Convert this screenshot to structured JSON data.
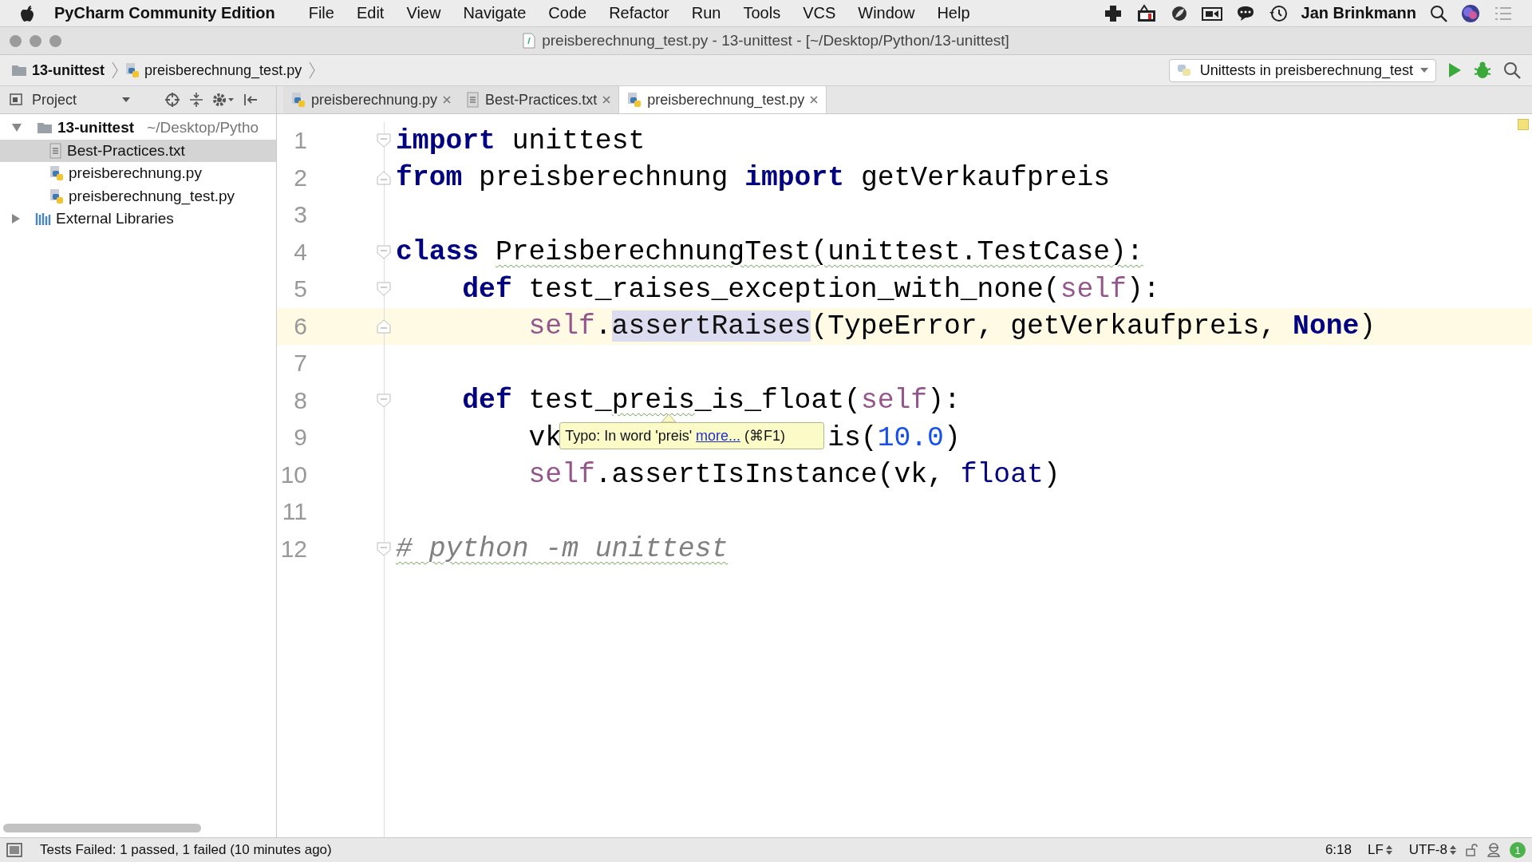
{
  "menu_bar": {
    "app_name": "PyCharm Community Edition",
    "menus": [
      "File",
      "Edit",
      "View",
      "Navigate",
      "Code",
      "Refactor",
      "Run",
      "Tools",
      "VCS",
      "Window",
      "Help"
    ],
    "user": "Jan Brinkmann"
  },
  "window": {
    "title": "preisberechnung_test.py - 13-unittest - [~/Desktop/Python/13-unittest]"
  },
  "breadcrumbs": [
    {
      "label": "13-unittest",
      "kind": "folder"
    },
    {
      "label": "preisberechnung_test.py",
      "kind": "python"
    }
  ],
  "run_config": {
    "label": "Unittests in preisberechnung_test"
  },
  "project_panel": {
    "title": "Project",
    "tree": [
      {
        "label": "13-unittest",
        "path": "~/Desktop/Pytho",
        "kind": "folder",
        "expanded": true,
        "selected": false,
        "children": [
          {
            "label": "Best-Practices.txt",
            "kind": "text",
            "selected": true
          },
          {
            "label": "preisberechnung.py",
            "kind": "python",
            "selected": false
          },
          {
            "label": "preisberechnung_test.py",
            "kind": "python",
            "selected": false
          }
        ]
      },
      {
        "label": "External Libraries",
        "kind": "library",
        "expanded": false,
        "selected": false
      }
    ]
  },
  "editor_tabs": [
    {
      "label": "preisberechnung.py",
      "kind": "python",
      "selected": false
    },
    {
      "label": "Best-Practices.txt",
      "kind": "text",
      "selected": false
    },
    {
      "label": "preisberechnung_test.py",
      "kind": "python",
      "selected": true
    }
  ],
  "editor": {
    "lines": [
      {
        "number": "1",
        "fold_start": true,
        "fold_end": false,
        "current": false,
        "tokens": [
          {
            "text": "import",
            "kind": "keyword"
          },
          {
            "text": " unittest",
            "kind": "plain"
          }
        ]
      },
      {
        "number": "2",
        "fold_start": false,
        "fold_end": true,
        "current": false,
        "tokens": [
          {
            "text": "from",
            "kind": "keyword"
          },
          {
            "text": " preisberechnung ",
            "kind": "plain"
          },
          {
            "text": "import",
            "kind": "keyword"
          },
          {
            "text": " getVerkaufpreis",
            "kind": "plain"
          }
        ]
      },
      {
        "number": "3",
        "fold_start": false,
        "fold_end": false,
        "current": false
      },
      {
        "number": "4",
        "fold_start": true,
        "fold_end": false,
        "current": false,
        "tokens": [
          {
            "text": "class",
            "kind": "keyword"
          },
          {
            "text": " PreisberechnungTest(unittest.TestCase):",
            "kind": "plain",
            "typo": true
          }
        ],
        "children": [
          {
            "number": "5",
            "fold_start": true,
            "fold_end": false,
            "current": false,
            "tokens": [
              {
                "text": "def",
                "kind": "keyword"
              },
              {
                "text": " test_raises_exception_with_none(",
                "kind": "plain"
              },
              {
                "text": "self",
                "kind": "self"
              },
              {
                "text": "):",
                "kind": "plain"
              }
            ],
            "children": [
              {
                "number": "6",
                "fold_start": false,
                "fold_end": true,
                "current": true,
                "tokens": [
                  {
                    "text": "self",
                    "kind": "self"
                  },
                  {
                    "text": ".",
                    "kind": "plain"
                  },
                  {
                    "text": "assertRaises",
                    "kind": "usage"
                  },
                  {
                    "text": "(TypeError, getVerkaufpreis, ",
                    "kind": "plain"
                  },
                  {
                    "text": "None",
                    "kind": "keyword"
                  },
                  {
                    "text": ")",
                    "kind": "plain"
                  }
                ]
              }
            ]
          },
          {
            "number": "7",
            "fold_start": false,
            "fold_end": false,
            "current": false
          },
          {
            "number": "8",
            "fold_start": true,
            "fold_end": false,
            "current": false,
            "tokens": [
              {
                "text": "def",
                "kind": "keyword"
              },
              {
                "text": " test_",
                "kind": "plain"
              },
              {
                "text": "preis",
                "kind": "plain",
                "typo": true
              },
              {
                "text": "_is_float(",
                "kind": "plain"
              },
              {
                "text": "self",
                "kind": "self"
              },
              {
                "text": "):",
                "kind": "plain"
              }
            ],
            "children": [
              {
                "number": "9",
                "fold_start": false,
                "fold_end": false,
                "current": false,
                "tokens": [
                  {
                    "text": "vk",
                    "kind": "plain"
                  },
                  {
                    "kind": "tooltip",
                    "text": "Typo: In word 'preis' ",
                    "link": "more...",
                    "shortcut": "(⌘F1)"
                  },
                  {
                    "text": "is(",
                    "kind": "plain"
                  },
                  {
                    "text": "10.0",
                    "kind": "number"
                  },
                  {
                    "text": ")",
                    "kind": "plain"
                  }
                ]
              },
              {
                "number": "10",
                "fold_start": false,
                "fold_end": false,
                "current": false,
                "tokens": [
                  {
                    "text": "self",
                    "kind": "self"
                  },
                  {
                    "text": ".assertIsInstance(vk, ",
                    "kind": "plain"
                  },
                  {
                    "text": "float",
                    "kind": "builtin"
                  },
                  {
                    "text": ")",
                    "kind": "plain"
                  }
                ]
              }
            ]
          },
          {
            "number": "11",
            "fold_start": false,
            "fold_end": false,
            "current": false
          }
        ]
      },
      {
        "number": "12",
        "fold_start": true,
        "fold_end": false,
        "current": false,
        "tokens": [
          {
            "text": "# python -m unittest",
            "kind": "comment",
            "typo": true
          }
        ]
      }
    ]
  },
  "status_bar": {
    "message": "Tests Failed: 1 passed, 1 failed (10 minutes ago)",
    "position": "6:18",
    "line_separator": "LF",
    "encoding": "UTF-8",
    "notifications": "1"
  }
}
